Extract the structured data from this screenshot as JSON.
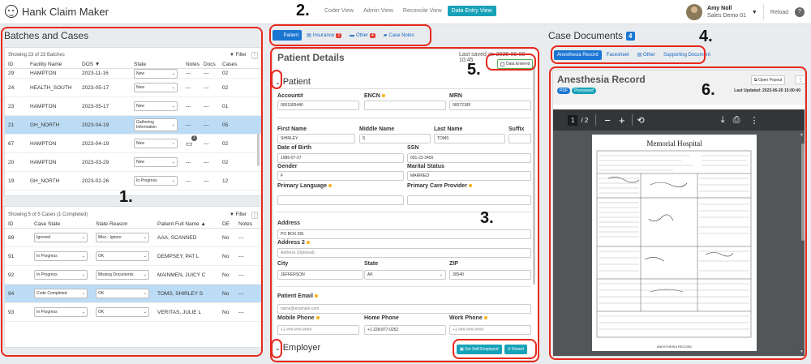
{
  "app": {
    "title": "Hank Claim Maker"
  },
  "views": [
    {
      "label": "Coder View",
      "active": false
    },
    {
      "label": "Admin View",
      "active": false
    },
    {
      "label": "Reconcile View",
      "active": false
    },
    {
      "label": "Data Entry View",
      "active": true
    }
  ],
  "user": {
    "name": "Amy Noll",
    "role": "Sales Demo 01",
    "reload": "Reload",
    "help": "?"
  },
  "left": {
    "title": "Batches and Cases",
    "batches": {
      "showing": "Showing 23 of 23 Batches",
      "filter": "Filter",
      "columns": [
        "ID",
        "Facility Name",
        "DOS",
        "State",
        "Notes",
        "Docs",
        "Cases"
      ],
      "rows": [
        {
          "id": "29",
          "facility": "HAMPTON",
          "dos": "2023-11-16",
          "state": "New",
          "notes": "---",
          "docs": "---",
          "cases": "02"
        },
        {
          "id": "24",
          "facility": "HEALTH_SOUTH",
          "dos": "2023-05-17",
          "state": "New",
          "notes": "---",
          "docs": "---",
          "cases": "02"
        },
        {
          "id": "23",
          "facility": "HAMPTON",
          "dos": "2023-05-17",
          "state": "New",
          "notes": "---",
          "docs": "---",
          "cases": "01"
        },
        {
          "id": "21",
          "facility": "GH_NORTH",
          "dos": "2023-04-19",
          "state": "Gathering Information",
          "notes": "---",
          "docs": "---",
          "cases": "05"
        },
        {
          "id": "67",
          "facility": "HAMPTON",
          "dos": "2023-04-19",
          "state": "New",
          "notes": "",
          "notes_count": "1",
          "docs": "---",
          "cases": "02"
        },
        {
          "id": "20",
          "facility": "HAMPTON",
          "dos": "2023-03-29",
          "state": "New",
          "notes": "---",
          "docs": "---",
          "cases": "02"
        },
        {
          "id": "19",
          "facility": "GH_NORTH",
          "dos": "2023-02-26",
          "state": "In Progress",
          "notes": "---",
          "docs": "---",
          "cases": "12"
        }
      ]
    },
    "cases": {
      "showing": "Showing 5 of 5 Cases (1 Completed)",
      "filter": "Filter",
      "columns": [
        "ID",
        "Case State",
        "State Reason",
        "Patient Full Name",
        "DE",
        "Notes"
      ],
      "rows": [
        {
          "id": "89",
          "state": "Ignored",
          "reason": "Misc.: Ignore",
          "name": "AAA, SCANNED",
          "de": "No",
          "notes": "---"
        },
        {
          "id": "91",
          "state": "In Progress",
          "reason": "OK",
          "name": "DEMPSEY, PAT L",
          "de": "No",
          "notes": "---"
        },
        {
          "id": "92",
          "state": "In Progress",
          "reason": "Missing Documents",
          "name": "MAINMEN, JUICY C",
          "de": "No",
          "notes": "---"
        },
        {
          "id": "94",
          "state": "Code Completed",
          "reason": "OK",
          "name": "TOMS, SHIRLEY S",
          "de": "No",
          "notes": "---"
        },
        {
          "id": "93",
          "state": "In Progress",
          "reason": "OK",
          "name": "VERITAS, JULIE L",
          "de": "No",
          "notes": "---"
        }
      ]
    }
  },
  "middle": {
    "tabs": [
      {
        "label": "Patient",
        "badge": "",
        "active": true
      },
      {
        "label": "Insurance",
        "badge": "2",
        "active": false
      },
      {
        "label": "Other",
        "badge": "4",
        "active": false
      },
      {
        "label": "Case Notes",
        "badge": "",
        "active": false
      }
    ],
    "title": "Patient Details",
    "last_saved": "Last saved at: 2025-09-09 10:45",
    "data_entered": "Data Entered",
    "section_patient": "Patient",
    "section_employer": "Employer",
    "fields": {
      "account_lbl": "Account#",
      "account": "0001905440",
      "encn_lbl": "ENCN",
      "encn": "",
      "mrn_lbl": "MRN",
      "mrn": "00072185",
      "first_lbl": "First Name",
      "first": "SHIRLEY",
      "middle_lbl": "Middle Name",
      "middle": "S",
      "last_lbl": "Last Name",
      "last": "TOMS",
      "suffix_lbl": "Suffix",
      "suffix": "",
      "dob_lbl": "Date of Birth",
      "dob": "1986-07-27",
      "ssn_lbl": "SSN",
      "ssn": "001-22-3456",
      "gender_lbl": "Gender",
      "gender": "F",
      "marital_lbl": "Marital Status",
      "marital": "MARRIED",
      "lang_lbl": "Primary Language",
      "lang": "",
      "pcp_lbl": "Primary Care Provider",
      "pcp": "",
      "address_lbl": "Address",
      "address": "PO BOX 281",
      "address2_lbl": "Address 2",
      "address2_ph": "Address (Optional)",
      "city_lbl": "City",
      "city": "JEFFERSON",
      "state_lbl": "State",
      "state": "AK",
      "zip_lbl": "ZIP",
      "zip": "30540",
      "email_lbl": "Patient Email",
      "email_ph": "name@example.com",
      "mobile_lbl": "Mobile Phone",
      "mobile_ph": "+1 ###-###-####",
      "home_lbl": "Home Phone",
      "home": "+1 228-877-0252",
      "work_lbl": "Work Phone",
      "work_ph": "+1 ###-###-####"
    },
    "btn_self_employed": "Set Self-Employed",
    "btn_revert": "Revert"
  },
  "right": {
    "title": "Case Documents",
    "count": "4",
    "tabs": [
      {
        "label": "Anesthesia Record",
        "active": true
      },
      {
        "label": "Facesheet",
        "active": false
      },
      {
        "label": "Other",
        "active": false
      },
      {
        "label": "Supporting Document",
        "active": false
      }
    ],
    "doc_title": "Anesthesia Record",
    "pill_pdf": "PDF",
    "pill_processed": "Processed",
    "open_popout": "Open Popout",
    "last_updated": "Last Updated: 2023-06-20 15:00:40",
    "page_current": "1",
    "page_total": "/ 2",
    "doc_hospital": "Memorial Hospital",
    "doc_footer": "ANESTHESIA RECORD"
  },
  "markers": [
    "1.",
    "2.",
    "3.",
    "4.",
    "5.",
    "6."
  ],
  "colors": {
    "accent": "#17a2b8",
    "primary": "#1976d2",
    "highlight": "#e8281c",
    "selected_row": "#bcdcf5"
  }
}
